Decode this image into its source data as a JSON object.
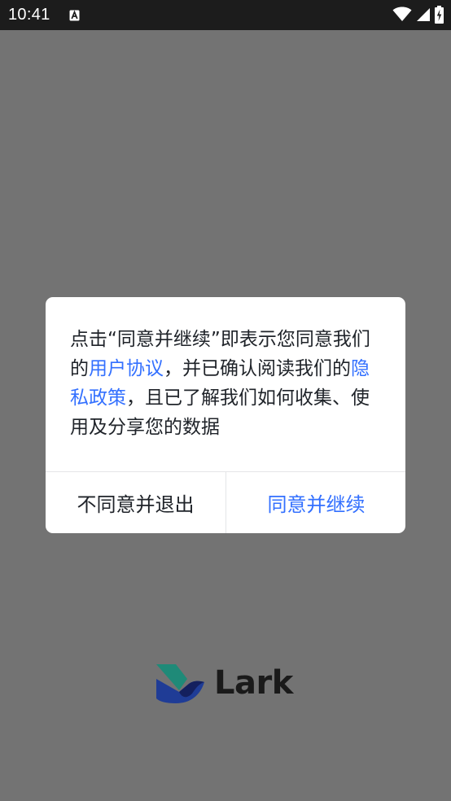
{
  "status_bar": {
    "time": "10:41",
    "notification_icon": "a-letter-icon",
    "wifi_icon": "wifi-icon",
    "signal_icon": "cellular-signal-icon",
    "battery_icon": "battery-charging-icon"
  },
  "dialog": {
    "message": {
      "part1": "点击“同意并继续”即表示您同意我们的",
      "user_agreement_link": "用户协议",
      "part2": "，并已确认阅读我们的",
      "privacy_policy_link": "隐私政策",
      "part3": "，且已了解我们如何收集、使用及分享您的数据"
    },
    "decline_label": "不同意并退出",
    "agree_label": "同意并继续"
  },
  "brand": {
    "name": "Lark"
  },
  "colors": {
    "link": "#3370ff",
    "text": "#1f2329",
    "scrim": "#737373",
    "logo_teal": "#1f8a78",
    "logo_blue": "#1f3c96",
    "logo_navy": "#14205e"
  }
}
